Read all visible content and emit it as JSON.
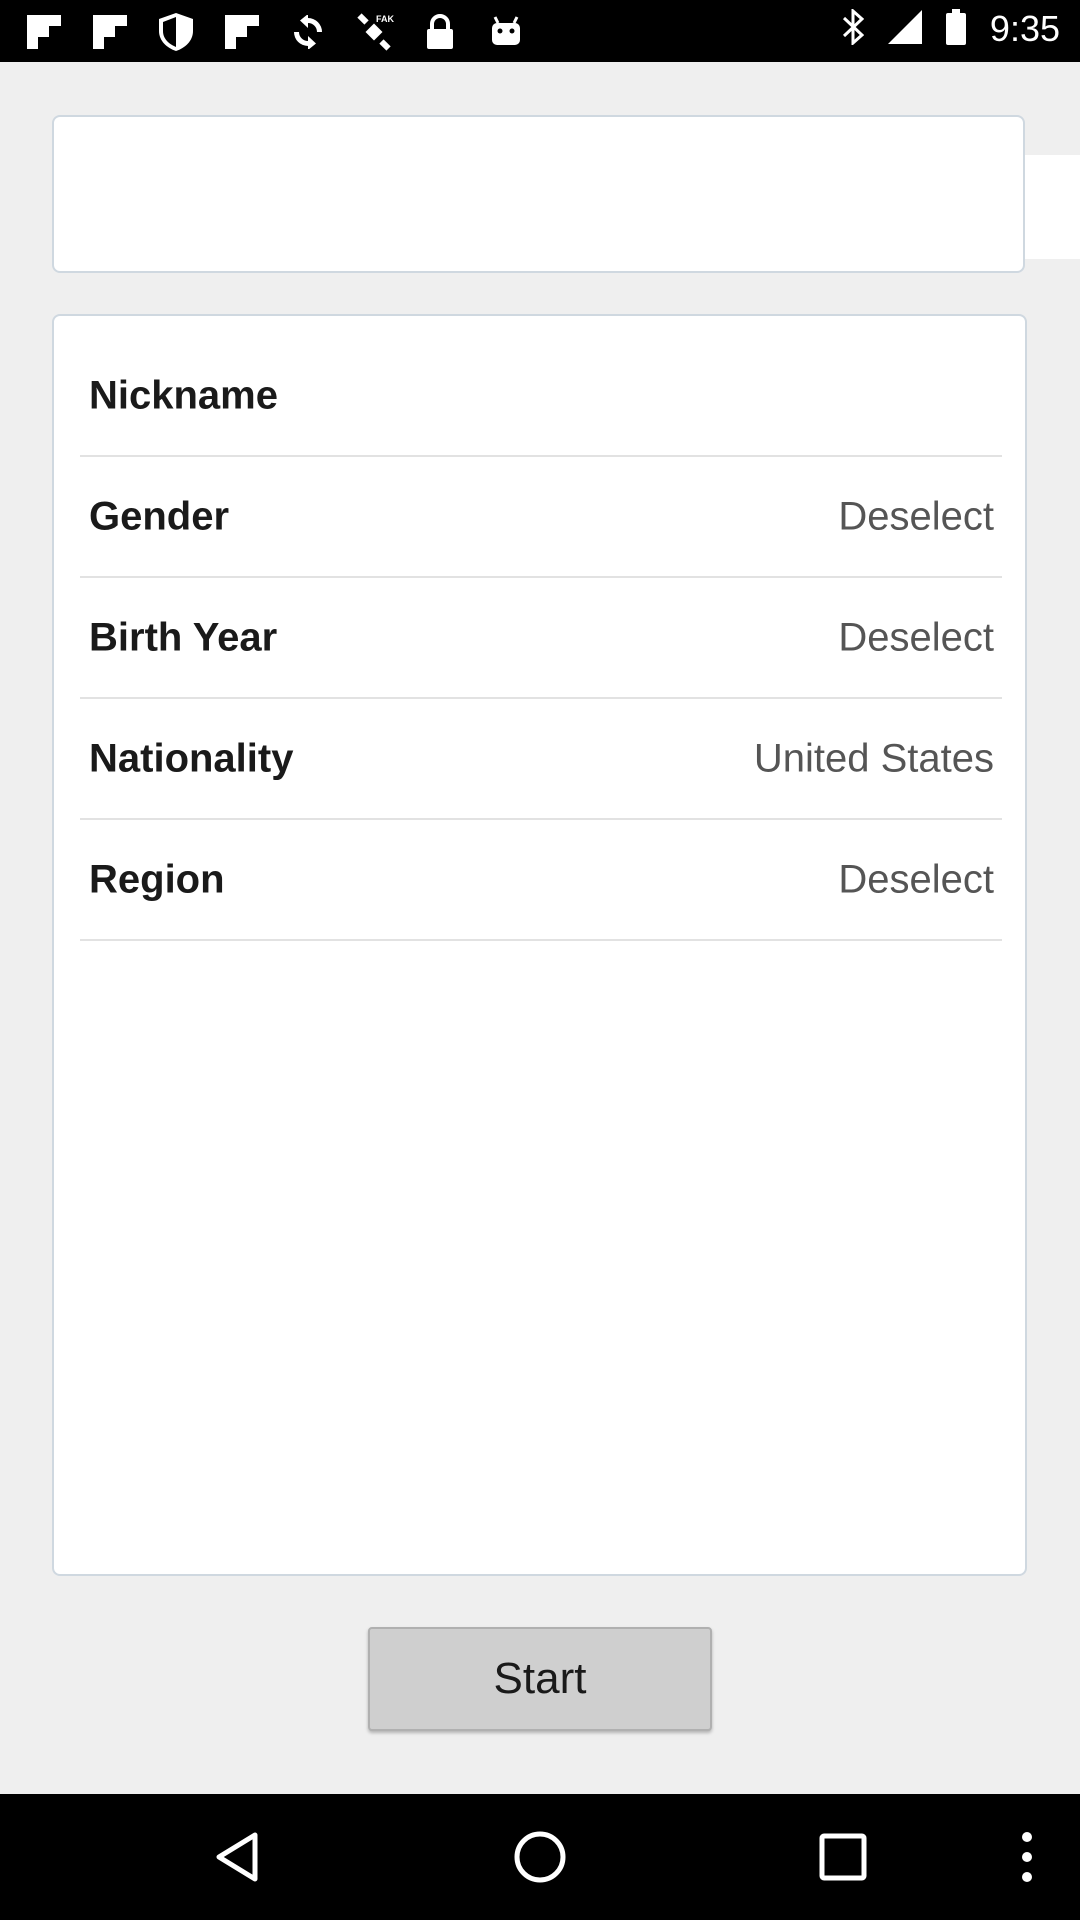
{
  "status_bar": {
    "time": "9:35",
    "left_icons": [
      "flipboard-icon",
      "flipboard-icon",
      "shield-icon",
      "flipboard-icon",
      "sync-icon",
      "fake-gps-icon",
      "lock-icon",
      "android-icon"
    ],
    "right_icons": [
      "bluetooth-icon",
      "signal-icon",
      "battery-icon"
    ]
  },
  "profile": {
    "rows": [
      {
        "label": "Nickname",
        "value": ""
      },
      {
        "label": "Gender",
        "value": "Deselect"
      },
      {
        "label": "Birth Year",
        "value": "Deselect"
      },
      {
        "label": "Nationality",
        "value": "United States"
      },
      {
        "label": "Region",
        "value": "Deselect"
      }
    ]
  },
  "actions": {
    "start_label": "Start"
  },
  "nav_bar": {
    "buttons": [
      "back-icon",
      "home-icon",
      "recents-icon",
      "overflow-menu-icon"
    ]
  },
  "colors": {
    "background": "#efefef",
    "card_border": "#cfd8e0",
    "button_bg": "#cfcfcf"
  }
}
